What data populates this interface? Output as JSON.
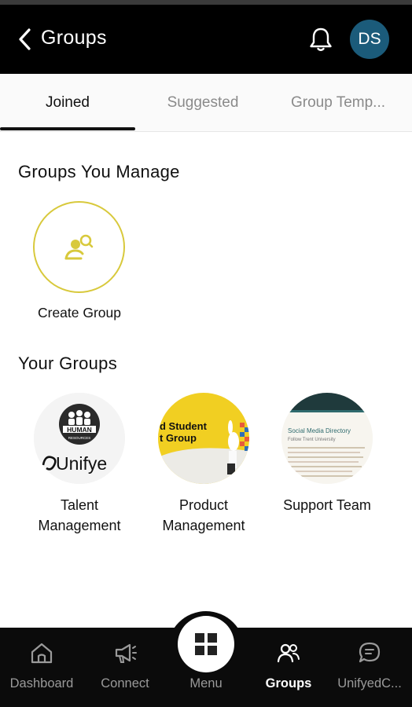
{
  "header": {
    "title": "Groups",
    "avatar_initials": "DS",
    "back_icon": "chevron-left-icon",
    "bell_icon": "bell-icon"
  },
  "tabs": [
    {
      "label": "Joined",
      "active": true
    },
    {
      "label": "Suggested",
      "active": false
    },
    {
      "label": "Group Temp...",
      "active": false
    }
  ],
  "manage": {
    "title": "Groups You Manage",
    "create_label": "Create Group",
    "create_icon": "add-user-icon",
    "accent": "#d8c93c"
  },
  "your_groups": {
    "title": "Your Groups",
    "items": [
      {
        "line1": "Talent",
        "line2": "Management",
        "logo_badge": "HUMAN",
        "logo_sub": "RESOURCES",
        "logo_text": "Unifye"
      },
      {
        "line1": "Product",
        "line2": "Management",
        "img_text_1": "d Student",
        "img_text_2": "t Group"
      },
      {
        "line1": "Support Team",
        "line2": "",
        "img_text_1": "Social Media Directory",
        "img_text_2": "Follow Trent University"
      }
    ]
  },
  "bottom_nav": {
    "items": [
      {
        "label": "Dashboard",
        "icon": "home-icon",
        "active": false
      },
      {
        "label": "Connect",
        "icon": "megaphone-icon",
        "active": false
      },
      {
        "label": "Menu",
        "icon": "grid-icon",
        "active": false
      },
      {
        "label": "Groups",
        "icon": "people-icon",
        "active": true
      },
      {
        "label": "UnifyedC...",
        "icon": "chat-icon",
        "active": false
      }
    ]
  },
  "colors": {
    "header_bg": "#000000",
    "avatar_bg": "#1b5b7a",
    "accent_yellow": "#d8c93c",
    "nav_bg": "#0b0b0b"
  }
}
